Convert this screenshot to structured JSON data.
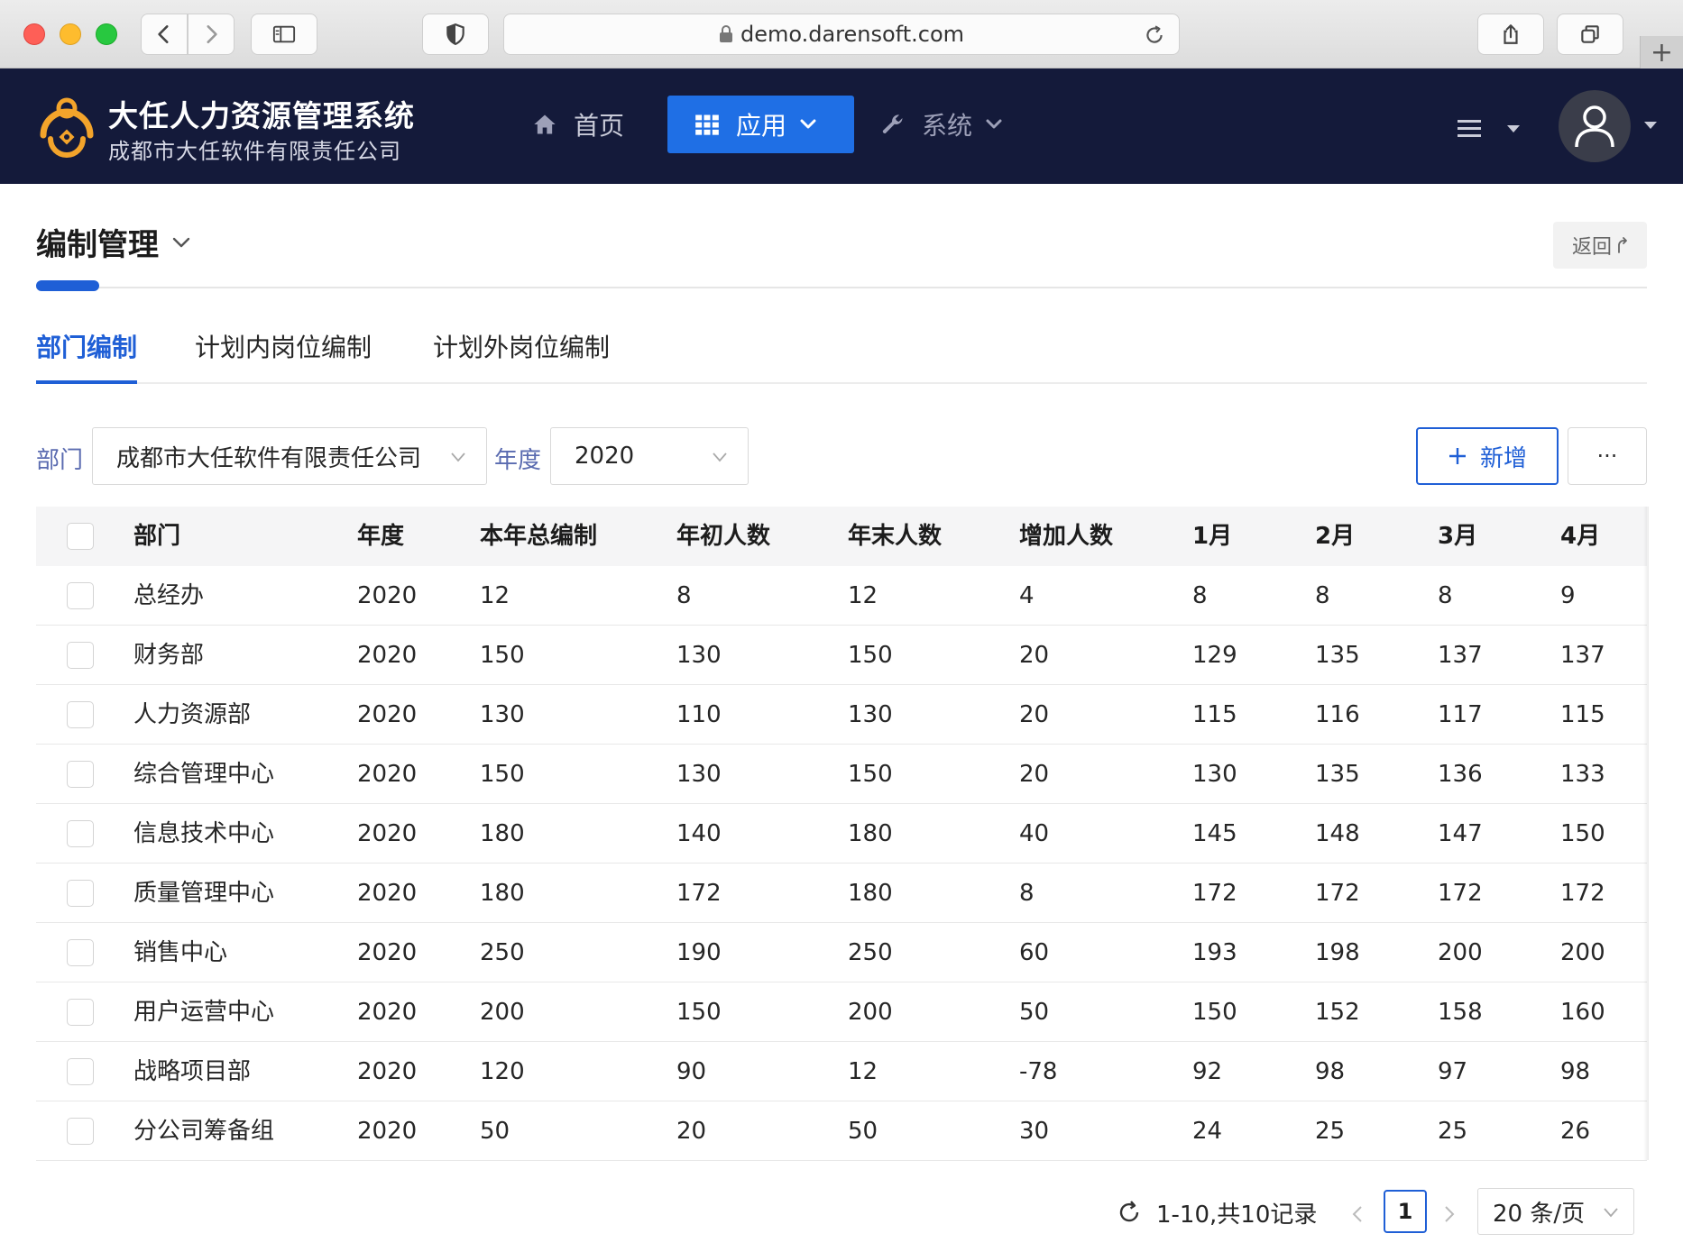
{
  "browser": {
    "url": "demo.darensoft.com"
  },
  "header": {
    "title": "大任人力资源管理系统",
    "subtitle": "成都市大任软件有限责任公司",
    "nav": {
      "home": "首页",
      "apps": "应用",
      "system": "系统"
    },
    "accent_color": "#1f6fe5",
    "bg_color": "#141a3a"
  },
  "page": {
    "title": "编制管理",
    "back_label": "返回",
    "tabs": [
      "部门编制",
      "计划内岗位编制",
      "计划外岗位编制"
    ],
    "active_tab": 0
  },
  "filters": {
    "dept_label": "部门",
    "dept_value": "成都市大任软件有限责任公司",
    "year_label": "年度",
    "year_value": "2020",
    "add_label": "新增",
    "more_label": "···"
  },
  "table": {
    "columns": [
      "部门",
      "年度",
      "本年总编制",
      "年初人数",
      "年末人数",
      "增加人数",
      "1月",
      "2月",
      "3月",
      "4月"
    ],
    "rows": [
      [
        "总经办",
        "2020",
        "12",
        "8",
        "12",
        "4",
        "8",
        "8",
        "8",
        "9"
      ],
      [
        "财务部",
        "2020",
        "150",
        "130",
        "150",
        "20",
        "129",
        "135",
        "137",
        "137"
      ],
      [
        "人力资源部",
        "2020",
        "130",
        "110",
        "130",
        "20",
        "115",
        "116",
        "117",
        "115"
      ],
      [
        "综合管理中心",
        "2020",
        "150",
        "130",
        "150",
        "20",
        "130",
        "135",
        "136",
        "133"
      ],
      [
        "信息技术中心",
        "2020",
        "180",
        "140",
        "180",
        "40",
        "145",
        "148",
        "147",
        "150"
      ],
      [
        "质量管理中心",
        "2020",
        "180",
        "172",
        "180",
        "8",
        "172",
        "172",
        "172",
        "172"
      ],
      [
        "销售中心",
        "2020",
        "250",
        "190",
        "250",
        "60",
        "193",
        "198",
        "200",
        "200"
      ],
      [
        "用户运营中心",
        "2020",
        "200",
        "150",
        "200",
        "50",
        "150",
        "152",
        "158",
        "160"
      ],
      [
        "战略项目部",
        "2020",
        "120",
        "90",
        "12",
        "-78",
        "92",
        "98",
        "97",
        "98"
      ],
      [
        "分公司筹备组",
        "2020",
        "50",
        "20",
        "50",
        "30",
        "24",
        "25",
        "25",
        "26"
      ]
    ]
  },
  "pagination": {
    "summary": "1-10,共10记录",
    "current_page": "1",
    "page_size": "20 条/页"
  }
}
